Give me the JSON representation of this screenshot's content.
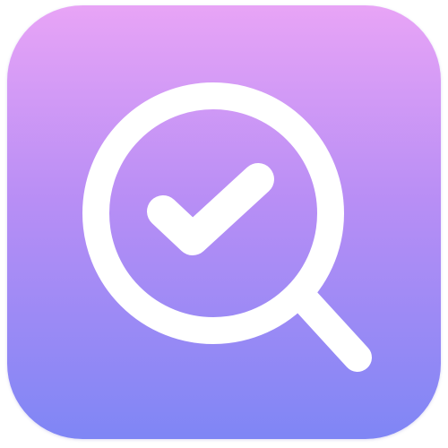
{
  "app_icon": {
    "icon": "magnifier-check-icon",
    "colors": {
      "gradient_top": "#e8a4f6",
      "gradient_mid": "#b88ef5",
      "gradient_bottom": "#7f86f5",
      "glyph": "#ffffff"
    }
  }
}
